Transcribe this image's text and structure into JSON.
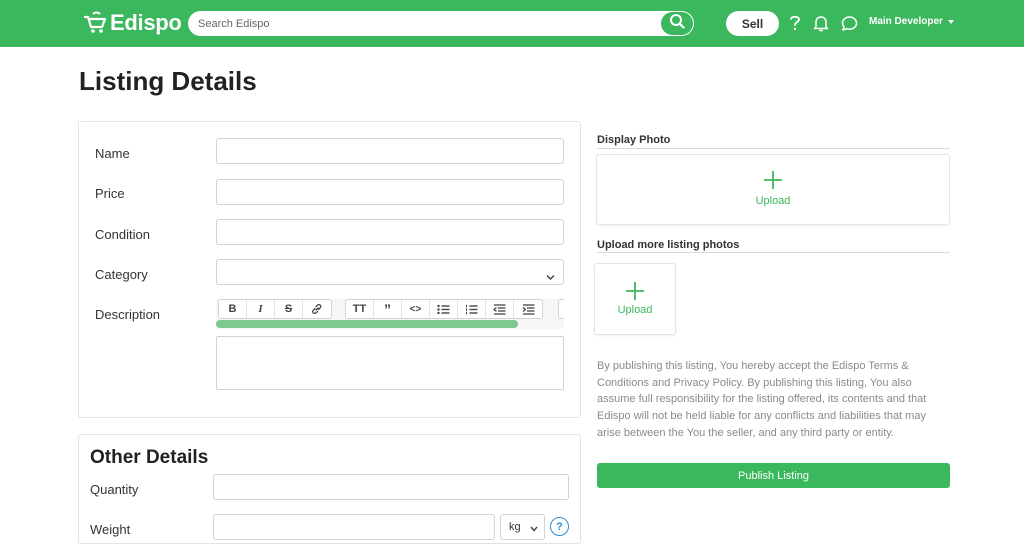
{
  "navbar": {
    "brand": "Edispo",
    "search_placeholder": "Search Edispo",
    "sell_label": "Sell",
    "user_name": "Main Developer"
  },
  "page": {
    "title": "Listing Details"
  },
  "form": {
    "name_label": "Name",
    "price_label": "Price",
    "condition_label": "Condition",
    "category_label": "Category",
    "description_label": "Description",
    "name_value": "",
    "price_value": "",
    "condition_value": "",
    "category_value": ""
  },
  "toolbar": {
    "buttons": [
      "B",
      "I",
      "S",
      "link",
      "TT",
      "”",
      "<>",
      "bullet-list",
      "numbered-list",
      "outdent",
      "indent"
    ]
  },
  "photos": {
    "display_heading": "Display Photo",
    "more_heading": "Upload more listing photos",
    "upload_label": "Upload"
  },
  "terms": {
    "text": "By publishing this listing, You hereby accept the Edispo Terms & Conditions and Privacy Policy. By publishing this listing, You also assume full responsibility for the listing offered, its contents and that Edispo will not be held liable for any conflicts and liabilities that may arise between the You the seller, and any third party or entity."
  },
  "publish_label": "Publish Listing",
  "other": {
    "title": "Other Details",
    "quantity_label": "Quantity",
    "weight_label": "Weight",
    "weight_unit": "kg",
    "help": "?"
  },
  "colors": {
    "brand": "#3bb75e",
    "help": "#2a8fd6"
  }
}
